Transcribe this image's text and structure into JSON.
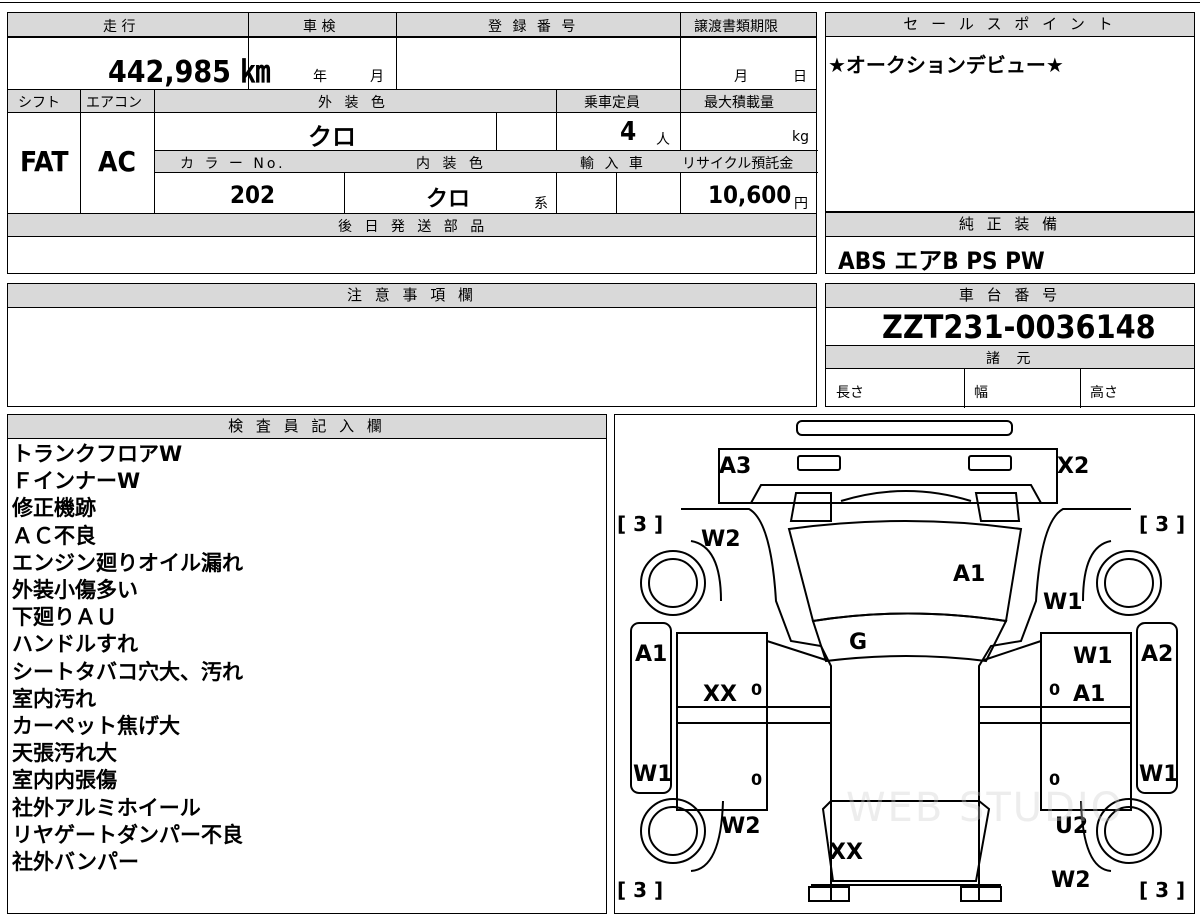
{
  "vehicle": {
    "mileage_label": "走 行",
    "mileage": "442,985 ㎞",
    "inspection_label": "車 検",
    "inspection_year": "年",
    "inspection_month": "月",
    "registration_label": "登 録 番 号",
    "transfer_label": "譲渡書類期限",
    "transfer_month": "月",
    "transfer_day": "日",
    "shift_label": "シフト",
    "shift": "FAT",
    "aircon_label": "エアコン",
    "aircon": "AC",
    "exterior_label": "外 装 色",
    "exterior": "クロ",
    "capacity_label": "乗車定員",
    "capacity": "4",
    "capacity_unit": "人",
    "maxload_label": "最大積載量",
    "maxload_unit": "kg",
    "color_no_label": "カ ラ ー No.",
    "color_no": "202",
    "interior_label": "内 装 色",
    "interior": "クロ",
    "interior_suffix": "系",
    "import_label": "輸 入 車",
    "recycle_label": "リサイクル預託金",
    "recycle": "10,600",
    "recycle_unit": "円",
    "later_parts_label": "後 日 発 送 部 品"
  },
  "sales": {
    "label": "セ ー ル ス ポ イ ン ト",
    "text": "★オークションデビュー★"
  },
  "equipment": {
    "label": "純 正 装 備",
    "text": "ABS エアB PS PW"
  },
  "notes": {
    "label": "注 意 事 項 欄"
  },
  "chassis": {
    "label": "車 台 番 号",
    "number": "ZZT231-0036148",
    "spec_label": "諸 元",
    "length": "長さ",
    "width": "幅",
    "height": "高さ"
  },
  "inspector": {
    "label": "検 査 員 記 入 欄",
    "lines": [
      "トランクフロアW",
      "ＦインナーW",
      "修正機跡",
      "ＡＣ不良",
      "エンジン廻りオイル漏れ",
      "外装小傷多い",
      "下廻りＡＵ",
      "ハンドルすれ",
      "シートタバコ穴大、汚れ",
      "室内汚れ",
      "カーペット焦げ大",
      "天張汚れ大",
      "室内内張傷",
      "社外アルミホイール",
      "リヤゲートダンパー不良",
      "社外バンパー"
    ]
  },
  "diagram": {
    "marks": {
      "a3": "A3",
      "x2": "X2",
      "w2_rear_left": "W2",
      "a1_trunk": "A1",
      "w1_rear_right": "W1",
      "g_glass": "G",
      "a1_left": "A1",
      "w1_right_door": "W1",
      "a2_right": "A2",
      "xx_left": "XX",
      "a1_right": "A1",
      "w1_left": "W1",
      "w1_right": "W1",
      "w2_front_left": "W2",
      "u2": "U2",
      "xx_front": "XX",
      "w2_front_right": "W2"
    },
    "tires": [
      "[ 3 ]",
      "[ 3 ]",
      "[ 3 ]",
      "[ 3 ]"
    ],
    "zeros": [
      "0",
      "0",
      "0",
      "0"
    ],
    "watermark": "WEB STUDIO"
  }
}
